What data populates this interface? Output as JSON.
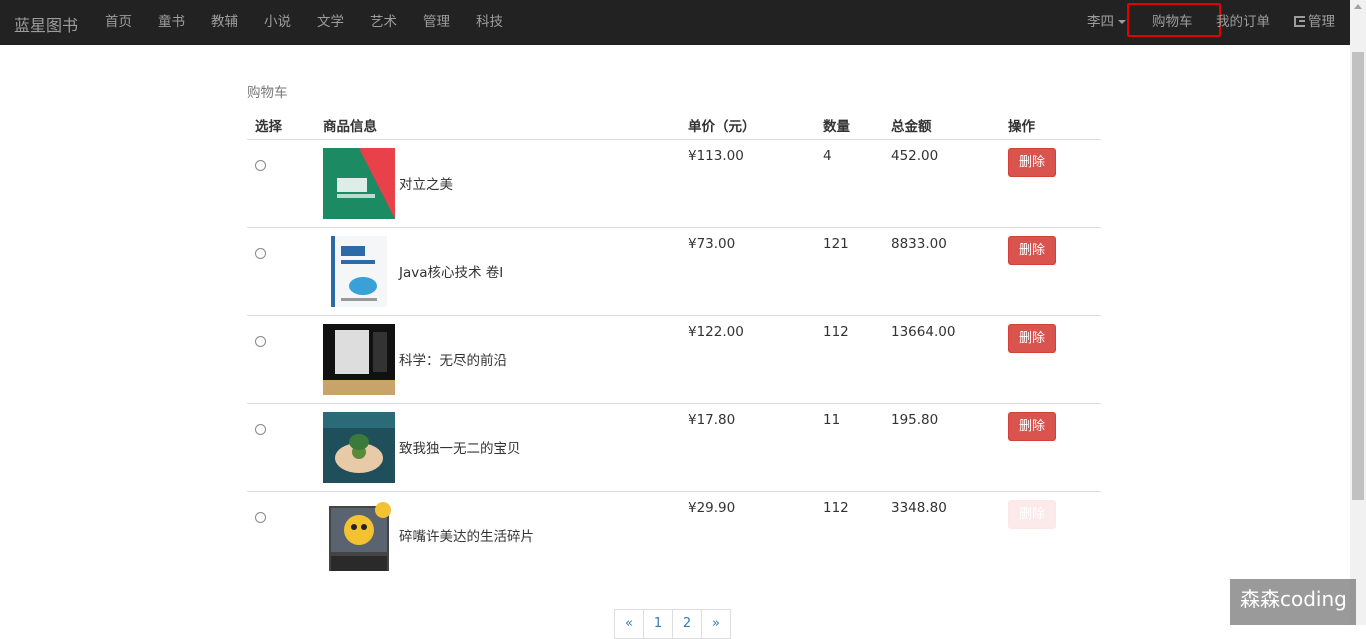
{
  "nav": {
    "brand": "蓝星图书",
    "items": [
      "首页",
      "童书",
      "教辅",
      "小说",
      "文学",
      "艺术",
      "管理",
      "科技"
    ],
    "user": "李四",
    "cart": "购物车",
    "orders": "我的订单",
    "admin": "管理"
  },
  "page": {
    "heading": "购物车"
  },
  "table": {
    "headers": [
      "选择",
      "商品信息",
      "单价（元）",
      "数量",
      "总金额",
      "操作"
    ],
    "rows": [
      {
        "name": "对立之美",
        "price": "¥113.00",
        "qty": "4",
        "total": "452.00",
        "action": "删除"
      },
      {
        "name": "Java核心技术 卷I",
        "price": "¥73.00",
        "qty": "121",
        "total": "8833.00",
        "action": "删除"
      },
      {
        "name": "科学：无尽的前沿",
        "price": "¥122.00",
        "qty": "112",
        "total": "13664.00",
        "action": "删除"
      },
      {
        "name": "致我独一无二的宝贝",
        "price": "¥17.80",
        "qty": "11",
        "total": "195.80",
        "action": "删除"
      },
      {
        "name": "碎嘴许美达的生活碎片",
        "price": "¥29.90",
        "qty": "112",
        "total": "3348.80",
        "action": "删除"
      }
    ]
  },
  "pagination": [
    "«",
    "1",
    "2",
    "»"
  ],
  "watermark": "森森coding",
  "colors": {
    "navbar": "#222222",
    "danger": "#d9534f",
    "highlight": "#e60000",
    "link": "#337ab7"
  },
  "icons": [
    "caret-down-icon",
    "logout-icon"
  ]
}
